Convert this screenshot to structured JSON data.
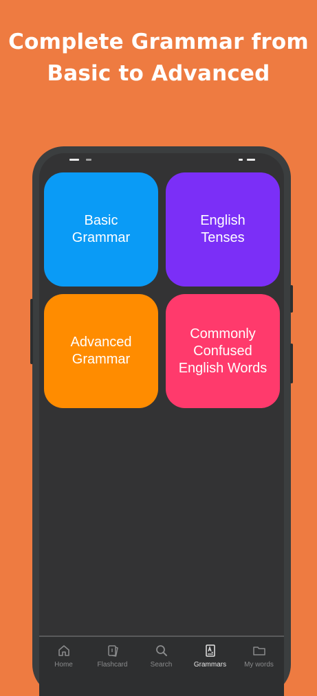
{
  "headline": {
    "line1": "Complete Grammar from",
    "line2": "Basic to Advanced"
  },
  "tiles": [
    {
      "label_lines": [
        "Basic",
        "Grammar"
      ],
      "color": "#0a9bf6"
    },
    {
      "label_lines": [
        "English",
        "Tenses"
      ],
      "color": "#7b2ff7"
    },
    {
      "label_lines": [
        "Advanced",
        "Grammar"
      ],
      "color": "#ff8c00"
    },
    {
      "label_lines": [
        "Commonly",
        "Confused",
        "English Words"
      ],
      "color": "#ff3a6c"
    }
  ],
  "bottom_nav": {
    "active": "Grammars",
    "items": [
      {
        "label": "Home",
        "icon": "home-icon"
      },
      {
        "label": "Flashcard",
        "icon": "flashcard-icon"
      },
      {
        "label": "Search",
        "icon": "search-icon"
      },
      {
        "label": "Grammars",
        "icon": "grammar-book-icon"
      },
      {
        "label": "My words",
        "icon": "folder-icon"
      }
    ]
  },
  "colors": {
    "background": "#ee7b41",
    "phone_frame": "#3b3e3f",
    "screen": "#333334",
    "nav_inactive": "#8a8b8c",
    "nav_active": "#e6e6e6"
  }
}
